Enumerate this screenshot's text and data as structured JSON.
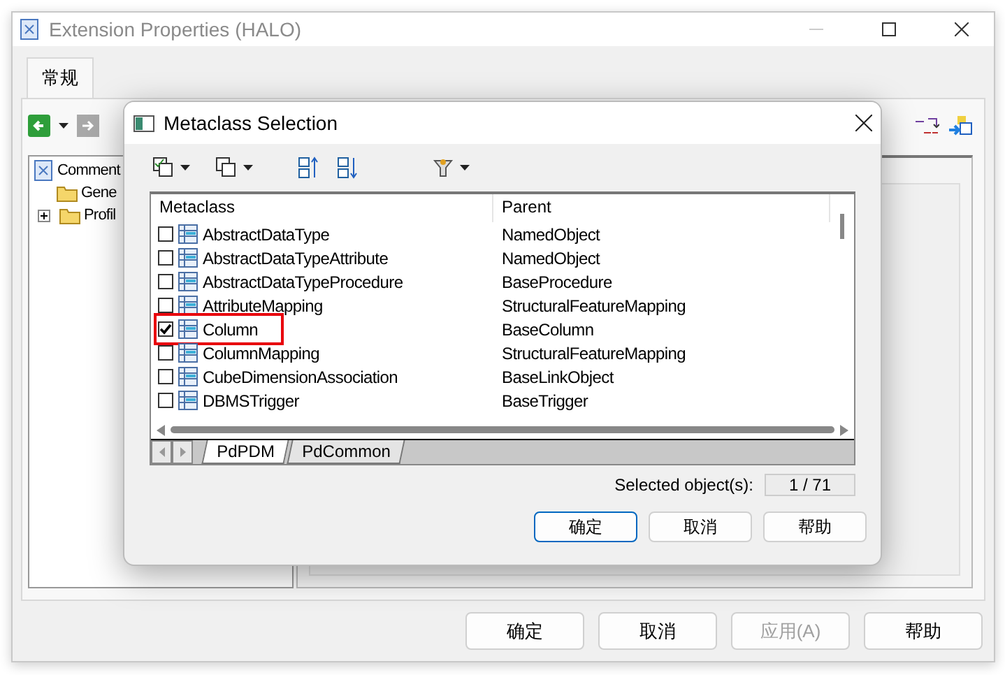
{
  "window": {
    "title": "Extension Properties (HALO)"
  },
  "tabs": [
    {
      "label": "常规",
      "selected": true
    }
  ],
  "tree": [
    {
      "label": "Comment",
      "children": [
        {
          "label": "Gene"
        },
        {
          "label": "Profil",
          "expanded": false
        }
      ]
    }
  ],
  "buttons": [
    {
      "label": "确定",
      "disabled": false
    },
    {
      "label": "取消",
      "disabled": false
    },
    {
      "label": "应用(A)",
      "disabled": true
    },
    {
      "label": "帮助",
      "disabled": false
    }
  ],
  "dialog": {
    "title": "Metaclass Selection",
    "columns": [
      "Metaclass",
      "Parent"
    ],
    "rows": [
      {
        "name": "AbstractDataType",
        "parent": "NamedObject",
        "checked": false,
        "highlighted": false
      },
      {
        "name": "AbstractDataTypeAttribute",
        "parent": "NamedObject",
        "checked": false,
        "highlighted": false
      },
      {
        "name": "AbstractDataTypeProcedure",
        "parent": "BaseProcedure",
        "checked": false,
        "highlighted": false
      },
      {
        "name": "AttributeMapping",
        "parent": "StructuralFeatureMapping",
        "checked": false,
        "highlighted": false
      },
      {
        "name": "Column",
        "parent": "BaseColumn",
        "checked": true,
        "highlighted": true
      },
      {
        "name": "ColumnMapping",
        "parent": "StructuralFeatureMapping",
        "checked": false,
        "highlighted": false
      },
      {
        "name": "CubeDimensionAssociation",
        "parent": "BaseLinkObject",
        "checked": false,
        "highlighted": false
      },
      {
        "name": "DBMSTrigger",
        "parent": "BaseTrigger",
        "checked": false,
        "highlighted": false
      }
    ],
    "sheet_tabs": [
      {
        "label": "PdPDM",
        "selected": true
      },
      {
        "label": "PdCommon",
        "selected": false
      }
    ],
    "selected_label": "Selected object(s):",
    "selected_count": "1 / 71",
    "buttons": [
      {
        "label": "确定",
        "default": true
      },
      {
        "label": "取消",
        "default": false
      },
      {
        "label": "帮助",
        "default": false
      }
    ]
  }
}
